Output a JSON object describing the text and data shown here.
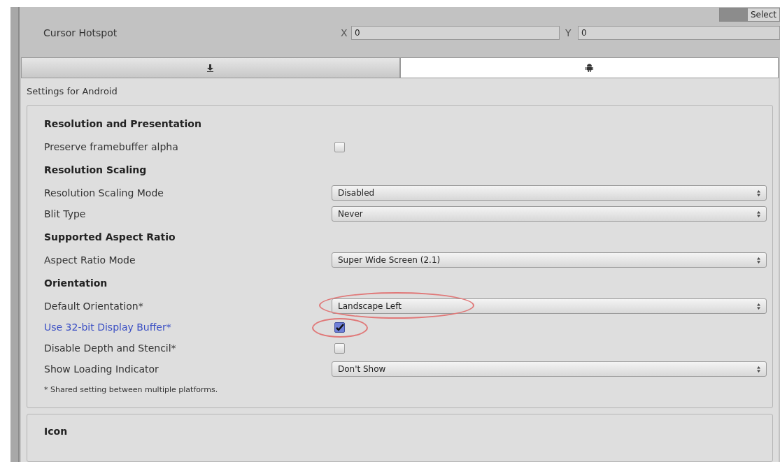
{
  "top_button": {
    "label": "Select"
  },
  "cursor_hotspot": {
    "label": "Cursor Hotspot",
    "x_label": "X",
    "x_value": "0",
    "y_label": "Y",
    "y_value": "0"
  },
  "platform_tabs": [
    {
      "kind": "download",
      "selected": false
    },
    {
      "kind": "android",
      "selected": true
    }
  ],
  "settings_title": "Settings for Android",
  "items": [
    {
      "kind": "heading",
      "label": "Resolution and Presentation"
    },
    {
      "kind": "checkbox",
      "label": "Preserve framebuffer alpha",
      "checked": false
    },
    {
      "kind": "heading",
      "label": "Resolution Scaling"
    },
    {
      "kind": "dropdown",
      "label": "Resolution Scaling Mode",
      "value": "Disabled"
    },
    {
      "kind": "dropdown",
      "label": "Blit Type",
      "value": "Never"
    },
    {
      "kind": "heading",
      "label": "Supported Aspect Ratio"
    },
    {
      "kind": "dropdown",
      "label": "Aspect Ratio Mode",
      "value": "Super Wide Screen (2.1)"
    },
    {
      "kind": "heading",
      "label": "Orientation"
    },
    {
      "kind": "dropdown",
      "label": "Default Orientation*",
      "value": "Landscape Left",
      "circled": true
    },
    {
      "kind": "checkbox",
      "label": "Use 32-bit Display Buffer*",
      "checked": true,
      "circled": true,
      "modified": true
    },
    {
      "kind": "checkbox",
      "label": "Disable Depth and Stencil*",
      "checked": false
    },
    {
      "kind": "dropdown",
      "label": "Show Loading Indicator",
      "value": "Don't Show"
    },
    {
      "kind": "note",
      "label": "* Shared setting between multiple platforms."
    }
  ],
  "next_section": "Icon"
}
